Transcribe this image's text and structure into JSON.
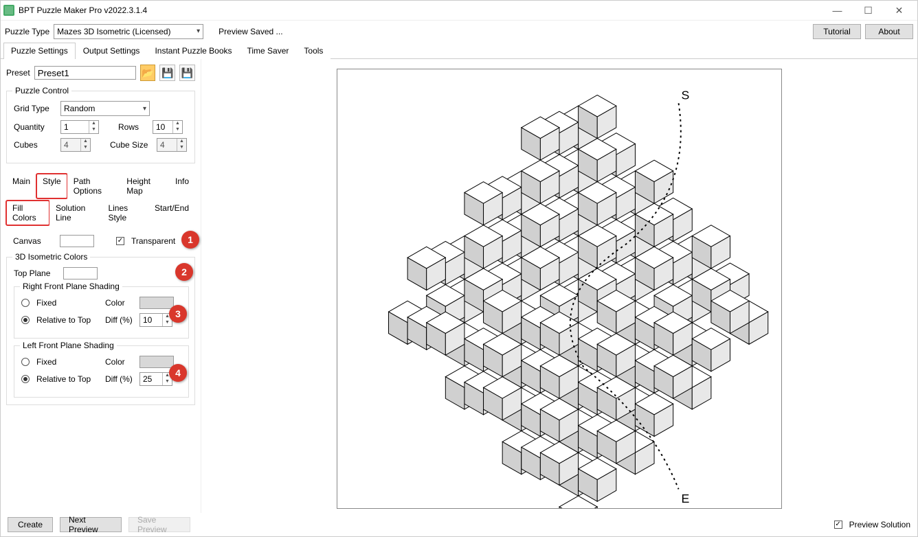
{
  "window": {
    "title": "BPT Puzzle Maker Pro v2022.3.1.4"
  },
  "toolbar": {
    "puzzle_type_label": "Puzzle Type",
    "puzzle_type_value": "Mazes 3D Isometric (Licensed)",
    "status": "Preview Saved ...",
    "tutorial": "Tutorial",
    "about": "About"
  },
  "maintabs": [
    "Puzzle Settings",
    "Output Settings",
    "Instant Puzzle Books",
    "Time Saver",
    "Tools"
  ],
  "preset": {
    "label": "Preset",
    "value": "Preset1"
  },
  "puzzle_control": {
    "legend": "Puzzle Control",
    "grid_type_label": "Grid Type",
    "grid_type_value": "Random",
    "quantity_label": "Quantity",
    "quantity_value": "1",
    "rows_label": "Rows",
    "rows_value": "10",
    "cubes_label": "Cubes",
    "cubes_value": "4",
    "cube_size_label": "Cube Size",
    "cube_size_value": "4"
  },
  "subtabs1": [
    "Main",
    "Style",
    "Path Options",
    "Height Map",
    "Info"
  ],
  "subtabs2": [
    "Fill Colors",
    "Solution Line",
    "Lines Style",
    "Start/End"
  ],
  "style": {
    "canvas_label": "Canvas",
    "transparent_label": "Transparent",
    "iso_legend": "3D Isometric Colors",
    "top_plane_label": "Top Plane",
    "right_legend": "Right Front Plane Shading",
    "left_legend": "Left Front Plane Shading",
    "fixed_label": "Fixed",
    "relative_label": "Relative to Top",
    "color_label": "Color",
    "diff_label": "Diff (%)",
    "right_diff": "10",
    "left_diff": "25"
  },
  "badges": [
    "1",
    "2",
    "3",
    "4"
  ],
  "footer": {
    "create": "Create",
    "next": "Next Preview",
    "save": "Save Preview",
    "preview_solution": "Preview Solution"
  },
  "maze": {
    "start": "S",
    "end": "E"
  }
}
